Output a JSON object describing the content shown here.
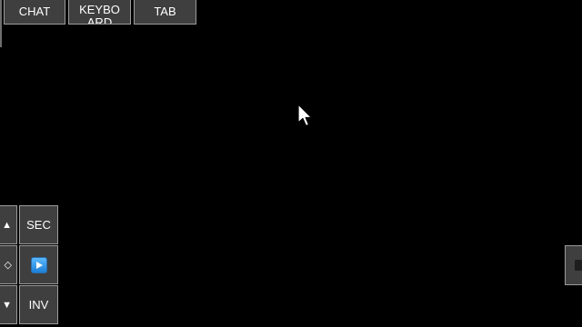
{
  "top_bar": {
    "chat_label": "CHAT",
    "keyboard_label": "KEYBOARD",
    "tab_label": "TAB"
  },
  "control_pad": {
    "up_glyph": "▲",
    "left_glyph": "◇",
    "down_glyph": "▼",
    "sec_label": "SEC",
    "play_icon": "play-icon",
    "inv_label": "INV"
  },
  "colors": {
    "background": "#000000",
    "button_fill": "#3f3f3f",
    "button_border": "#9a9a9a",
    "play_icon_blue": "#2f8fe8"
  }
}
